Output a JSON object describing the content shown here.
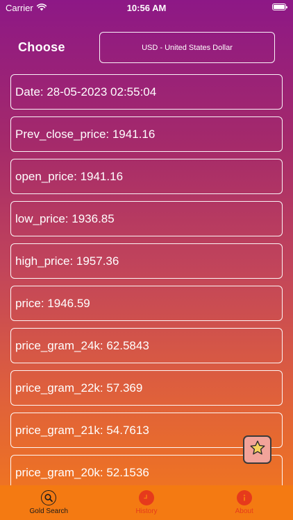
{
  "status_bar": {
    "carrier": "Carrier",
    "time": "10:56 AM"
  },
  "header": {
    "choose_label": "Choose",
    "currency_selected": "USD - United States Dollar"
  },
  "fields": [
    {
      "text": "Date: 28-05-2023 02:55:04"
    },
    {
      "text": "Prev_close_price: 1941.16"
    },
    {
      "text": "open_price: 1941.16"
    },
    {
      "text": "low_price: 1936.85"
    },
    {
      "text": "high_price: 1957.36"
    },
    {
      "text": "price: 1946.59"
    },
    {
      "text": "price_gram_24k: 62.5843"
    },
    {
      "text": "price_gram_22k: 57.369"
    },
    {
      "text": "price_gram_21k: 54.7613"
    },
    {
      "text": "price_gram_20k: 52.1536"
    }
  ],
  "tabs": [
    {
      "label": "Gold Search",
      "icon": "search-icon",
      "active": true
    },
    {
      "label": "History",
      "icon": "clock-icon",
      "active": false
    },
    {
      "label": "About",
      "icon": "info-icon",
      "active": false
    }
  ],
  "colors": {
    "gradient_top": "#8d1886",
    "gradient_bottom": "#f47a1a",
    "tab_bar": "#f47a12",
    "tab_inactive": "#e63a1c",
    "fav_button_bg": "#f2a39a",
    "star": "#f5d25c"
  },
  "fav_button": {
    "icon": "star-icon"
  }
}
